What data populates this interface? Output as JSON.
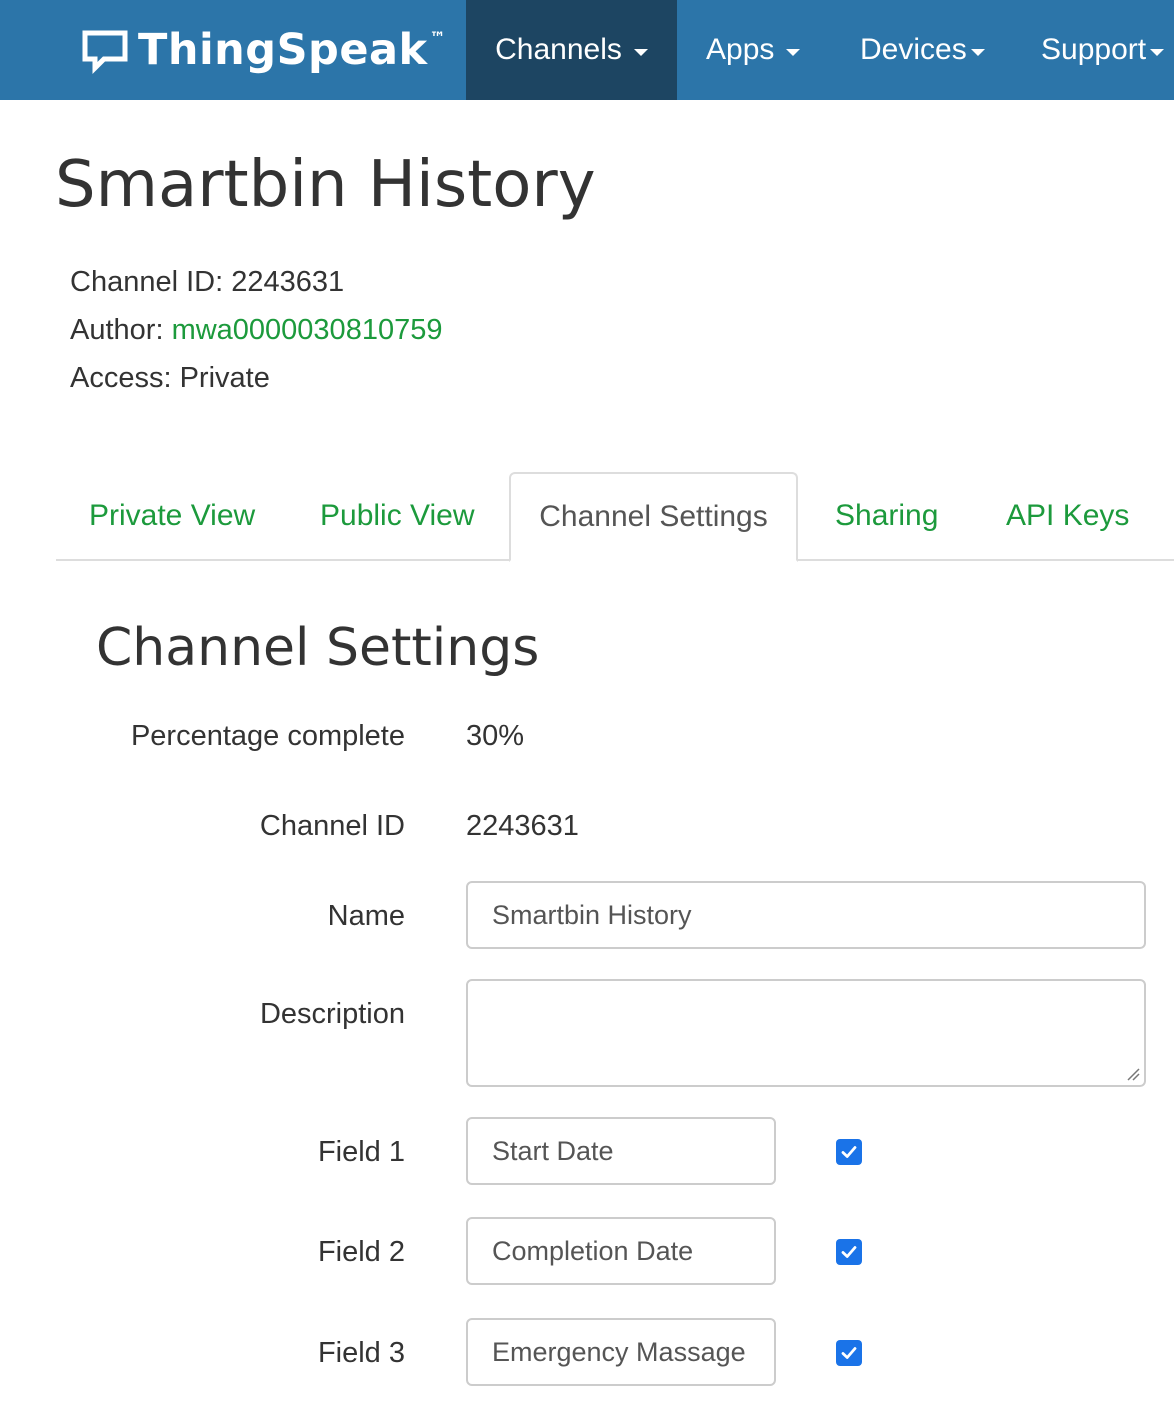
{
  "navbar": {
    "brand": "ThingSpeak",
    "brand_tm": "™",
    "items": [
      {
        "label": "Channels",
        "active": true
      },
      {
        "label": "Apps",
        "active": false
      },
      {
        "label": "Devices",
        "active": false
      },
      {
        "label": "Support",
        "active": false
      }
    ]
  },
  "channel": {
    "title": "Smartbin History",
    "id_label": "Channel ID:",
    "id_value": "2243631",
    "author_label": "Author:",
    "author_value": "mwa0000030810759",
    "access_label": "Access:",
    "access_value": "Private"
  },
  "tabs": [
    {
      "label": "Private View",
      "active": false
    },
    {
      "label": "Public View",
      "active": false
    },
    {
      "label": "Channel Settings",
      "active": true
    },
    {
      "label": "Sharing",
      "active": false
    },
    {
      "label": "API Keys",
      "active": false
    }
  ],
  "settings": {
    "title": "Channel Settings",
    "percentage_label": "Percentage complete",
    "percentage_value": "30%",
    "channel_id_label": "Channel ID",
    "channel_id_value": "2243631",
    "name_label": "Name",
    "name_value": "Smartbin History",
    "description_label": "Description",
    "description_value": "",
    "fields": [
      {
        "label": "Field 1",
        "value": "Start Date",
        "checked": true
      },
      {
        "label": "Field 2",
        "value": "Completion Date",
        "checked": true
      },
      {
        "label": "Field 3",
        "value": "Emergency Massage",
        "checked": true
      }
    ]
  },
  "colors": {
    "navbar": "#2c75a9",
    "navbar_active": "#1d4562",
    "link_green": "#1c9a3c",
    "checkbox_blue": "#1a73e8"
  }
}
